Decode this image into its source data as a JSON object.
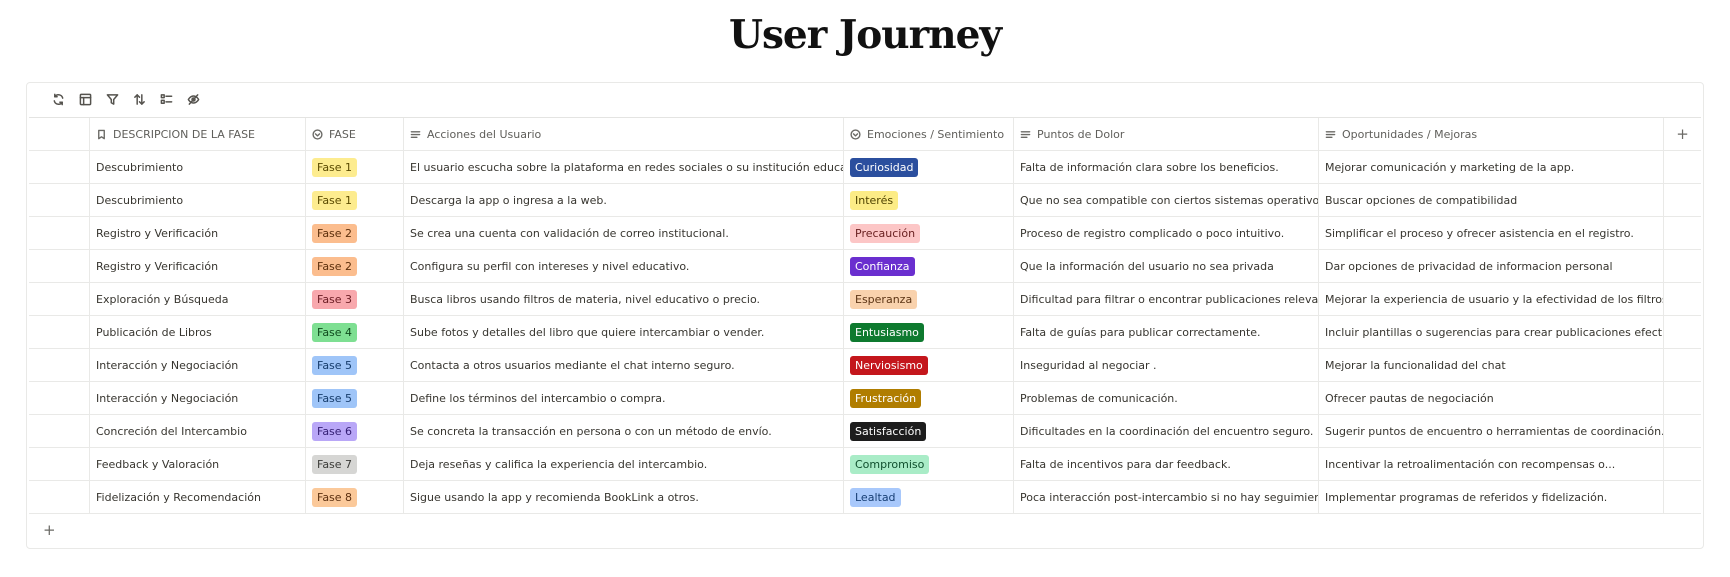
{
  "title": "User Journey",
  "columns": [
    {
      "label": "DESCRIPCION DE LA FASE",
      "icon": "bookmark-icon"
    },
    {
      "label": "FASE",
      "icon": "select-circle-icon"
    },
    {
      "label": "Acciones del Usuario",
      "icon": "text-lines-icon"
    },
    {
      "label": "Emociones / Sentimiento",
      "icon": "select-circle-icon"
    },
    {
      "label": "Puntos de Dolor",
      "icon": "text-lines-icon"
    },
    {
      "label": "Oportunidades / Mejoras",
      "icon": "text-lines-icon"
    }
  ],
  "add_column_label": "+",
  "add_row_label": "+",
  "rows": [
    {
      "descripcion": "Descubrimiento",
      "fase": "Fase 1",
      "fase_bg": "#fdec8f",
      "fase_fg": "#5a4a00",
      "acciones": "El usuario escucha sobre la plataforma en redes sociales o su institución educativa.",
      "emocion": "Curiosidad",
      "emo_bg": "#2b4f9e",
      "emo_fg": "#ffffff",
      "dolor": "Falta de información clara sobre los beneficios.",
      "oportunidad": "Mejorar comunicación y marketing de la app."
    },
    {
      "descripcion": "Descubrimiento",
      "fase": "Fase 1",
      "fase_bg": "#fdec8f",
      "fase_fg": "#5a4a00",
      "acciones": "Descarga la app o ingresa a la web.",
      "emocion": " Interés",
      "emo_bg": "#fcec86",
      "emo_fg": "#4f4300",
      "dolor": "Que no sea compatible con ciertos sistemas operativos",
      "oportunidad": "Buscar opciones de compatibilidad"
    },
    {
      "descripcion": "Registro y Verificación",
      "fase": "Fase 2",
      "fase_bg": "#fbbd8e",
      "fase_fg": "#5c2f0c",
      "acciones": "Se crea una cuenta con validación de correo institucional.",
      "emocion": " Precaución",
      "emo_bg": "#fcc6c6",
      "emo_fg": "#6a2121",
      "dolor": "Proceso de registro complicado o poco intuitivo.",
      "oportunidad": "Simplificar el proceso y ofrecer asistencia en el registro."
    },
    {
      "descripcion": "Registro y Verificación",
      "fase": "Fase 2",
      "fase_bg": "#fbbd8e",
      "fase_fg": "#5c2f0c",
      "acciones": "Configura su perfil con intereses y nivel educativo.",
      "emocion": "Confianza",
      "emo_bg": "#6a2fcf",
      "emo_fg": "#ffffff",
      "dolor": "Que la información del usuario no sea privada",
      "oportunidad": "Dar opciones de privacidad de informacion personal"
    },
    {
      "descripcion": "Exploración y Búsqueda",
      "fase": "Fase 3",
      "fase_bg": "#f8a8ad",
      "fase_fg": "#6a1b22",
      "acciones": "Busca libros usando filtros de materia, nivel educativo o precio.",
      "emocion": "Esperanza",
      "emo_bg": "#f9d2ad",
      "emo_fg": "#5c3414",
      "dolor": "Dificultad para filtrar o encontrar publicaciones relevantes.",
      "oportunidad": "Mejorar la experiencia de usuario y la efectividad de los filtros."
    },
    {
      "descripcion": " Publicación de Libros",
      "fase": "Fase 4",
      "fase_bg": "#7edf92",
      "fase_fg": "#0f4a1d",
      "acciones": "Sube fotos y detalles del libro que quiere intercambiar o vender.",
      "emocion": "Entusiasmo",
      "emo_bg": "#0e7a2f",
      "emo_fg": "#ffffff",
      "dolor": "Falta de guías para publicar correctamente.",
      "oportunidad": "Incluir plantillas o sugerencias para crear publicaciones efectivas."
    },
    {
      "descripcion": "Interacción y Negociación",
      "fase": "Fase 5",
      "fase_bg": "#9fc5f8",
      "fase_fg": "#163c6b",
      "acciones": "Contacta a otros usuarios mediante el chat interno seguro.",
      "emocion": "Nerviosismo",
      "emo_bg": "#c4161c",
      "emo_fg": "#ffffff",
      "dolor": "Inseguridad al negociar .",
      "oportunidad": "Mejorar la funcionalidad del chat"
    },
    {
      "descripcion": "Interacción y Negociación",
      "fase": "Fase 5",
      "fase_bg": "#9fc5f8",
      "fase_fg": "#163c6b",
      "acciones": "Define los términos del intercambio o compra.",
      "emocion": "Frustración",
      "emo_bg": "#b07d00",
      "emo_fg": "#ffffff",
      "dolor": "Problemas de comunicación.",
      "oportunidad": "Ofrecer pautas de negociación"
    },
    {
      "descripcion": "Concreción del Intercambio",
      "fase": "Fase 6",
      "fase_bg": "#b9a7f7",
      "fase_fg": "#331e73",
      "acciones": "Se concreta la transacción en persona o con un método de envío.",
      "emocion": "Satisfacción",
      "emo_bg": "#1d1d1d",
      "emo_fg": "#ffffff",
      "dolor": "Dificultades en la coordinación del encuentro seguro.",
      "oportunidad": "Sugerir puntos de encuentro o herramientas de coordinación."
    },
    {
      "descripcion": "Feedback y Valoración",
      "fase": "Fase 7",
      "fase_bg": "#d6d6d4",
      "fase_fg": "#3b3b38",
      "acciones": "Deja reseñas y califica la experiencia del intercambio.",
      "emocion": "Compromiso",
      "emo_bg": "#a9ecc7",
      "emo_fg": "#0f4f2d",
      "dolor": "Falta de incentivos para dar feedback.",
      "oportunidad": "Incentivar la retroalimentación con recompensas o..."
    },
    {
      "descripcion": " Fidelización y Recomendación",
      "fase": "Fase 8",
      "fase_bg": "#fbc99a",
      "fase_fg": "#5c3010",
      "acciones": "Sigue usando la app y recomienda BookLink a otros.",
      "emocion": "Lealtad",
      "emo_bg": "#a8c8fb",
      "emo_fg": "#173e74",
      "dolor": "Poca interacción post-intercambio si no hay seguimiento.",
      "oportunidad": "Implementar programas de referidos y fidelización."
    }
  ]
}
